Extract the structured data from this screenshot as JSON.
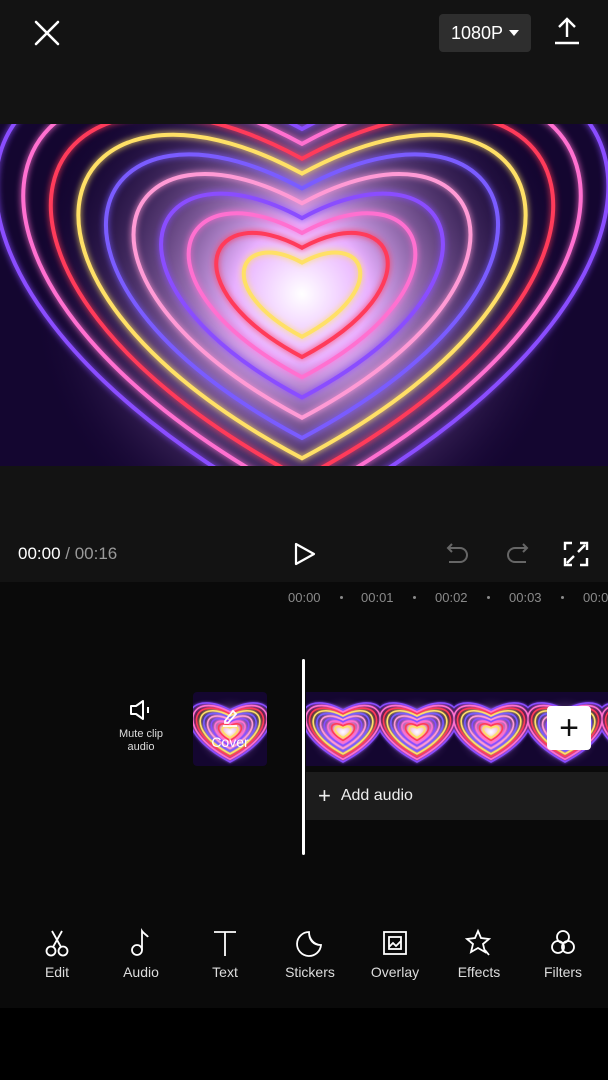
{
  "header": {
    "resolution": "1080P",
    "close_icon": "close-icon",
    "export_icon": "upload-icon"
  },
  "player": {
    "current_time": "00:00",
    "separator": " / ",
    "total_time": "00:16"
  },
  "ruler": [
    "00:00",
    "00:01",
    "00:02",
    "00:03",
    "00:0"
  ],
  "track": {
    "mute_label": "Mute clip audio",
    "cover_label": "Cover",
    "add_audio_label": "Add audio"
  },
  "toolbar": [
    {
      "label": "Edit",
      "icon": "scissors-icon"
    },
    {
      "label": "Audio",
      "icon": "music-note-icon"
    },
    {
      "label": "Text",
      "icon": "text-icon"
    },
    {
      "label": "Stickers",
      "icon": "sticker-icon"
    },
    {
      "label": "Overlay",
      "icon": "overlay-icon"
    },
    {
      "label": "Effects",
      "icon": "effects-star-icon"
    },
    {
      "label": "Filters",
      "icon": "filters-icon"
    }
  ],
  "colors": {
    "heart_colors": [
      "#8a4dff",
      "#ff6fd0",
      "#ff3a5a",
      "#ffe066",
      "#7a5cff",
      "#ff9ad5"
    ]
  }
}
